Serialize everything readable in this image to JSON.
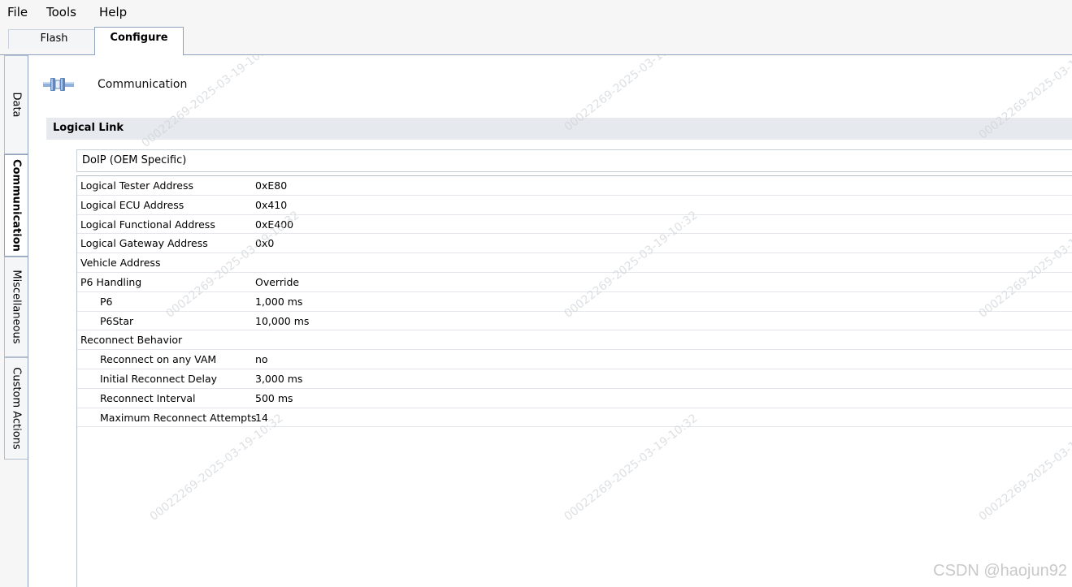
{
  "menu": {
    "file": "File",
    "tools": "Tools",
    "help": "Help"
  },
  "tabs": {
    "flash": "Flash",
    "configure": "Configure"
  },
  "side_tabs": {
    "data": "Data",
    "communication": "Communication",
    "miscellaneous": "Miscellaneous",
    "custom_actions": "Custom Actions"
  },
  "page": {
    "title": "Communication",
    "section": "Logical Link",
    "group": "DoIP (OEM Specific)"
  },
  "properties": [
    {
      "name": "Logical Tester Address",
      "value": "0xE80"
    },
    {
      "name": "Logical ECU Address",
      "value": "0x410"
    },
    {
      "name": "Logical Functional Address",
      "value": "0xE400"
    },
    {
      "name": "Logical Gateway Address",
      "value": "0x0"
    },
    {
      "name": "Vehicle Address",
      "value": ""
    },
    {
      "name": "P6 Handling",
      "value": "Override"
    },
    {
      "name": "P6",
      "value": "1,000 ms"
    },
    {
      "name": "P6Star",
      "value": "10,000 ms"
    },
    {
      "name": "Reconnect Behavior",
      "value": ""
    },
    {
      "name": "Reconnect on any VAM",
      "value": "no"
    },
    {
      "name": "Initial Reconnect Delay",
      "value": "3,000 ms"
    },
    {
      "name": "Reconnect Interval",
      "value": "500 ms"
    },
    {
      "name": "Maximum Reconnect Attempts",
      "value": "14"
    }
  ],
  "watermark": "00022269-2025-03-19-10:32",
  "credit": "CSDN @haojun92"
}
